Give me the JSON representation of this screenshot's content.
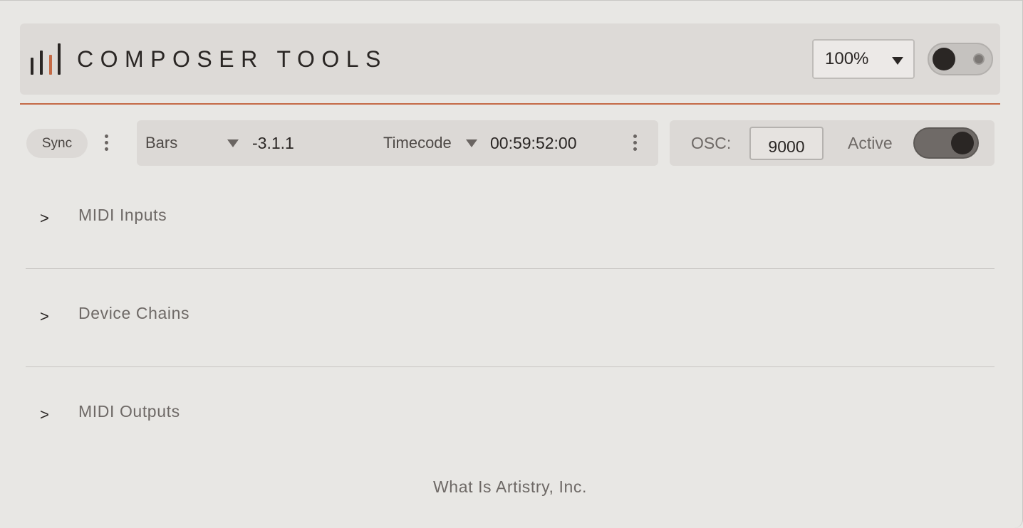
{
  "header": {
    "title": "COMPOSER TOOLS",
    "zoom": {
      "selected": "100%"
    },
    "power_toggle": {
      "on": false
    }
  },
  "transport": {
    "sync_label": "Sync",
    "position_mode": "Bars",
    "position_value": "-3.1.1",
    "time_mode": "Timecode",
    "time_value": "00:59:52:00"
  },
  "osc": {
    "label": "OSC:",
    "port": "9000",
    "active_label": "Active",
    "active": true
  },
  "sections": [
    {
      "chevron": ">",
      "label": "MIDI Inputs"
    },
    {
      "chevron": ">",
      "label": "Device Chains"
    },
    {
      "chevron": ">",
      "label": "MIDI Outputs"
    }
  ],
  "footer": {
    "text": "What Is Artistry, Inc."
  },
  "colors": {
    "accent": "#c46a46",
    "background": "#e8e7e4",
    "panel": "#dcd9d6",
    "text_dark": "#2a2624"
  },
  "icons": {
    "logo": "bars-logo-icon",
    "dropdown": "caret-down-icon",
    "more": "kebab-menu-icon",
    "expand": "chevron-right-icon"
  }
}
